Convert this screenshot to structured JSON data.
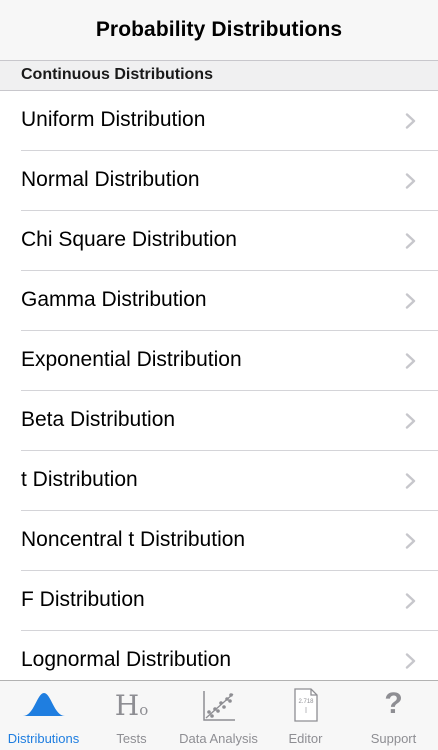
{
  "header": {
    "title": "Probability Distributions"
  },
  "section": {
    "title": "Continuous Distributions"
  },
  "list": {
    "items": [
      "Uniform Distribution",
      "Normal Distribution",
      "Chi Square Distribution",
      "Gamma Distribution",
      "Exponential Distribution",
      "Beta Distribution",
      "t Distribution",
      "Noncentral t Distribution",
      "F Distribution",
      "Lognormal Distribution"
    ]
  },
  "tabbar": {
    "tabs": [
      {
        "label": "Distributions",
        "icon": "bell-curve-icon",
        "active": true
      },
      {
        "label": "Tests",
        "icon": "hypothesis-icon",
        "glyph": "H",
        "subscript": "o"
      },
      {
        "label": "Data Analysis",
        "icon": "scatter-plot-icon"
      },
      {
        "label": "Editor",
        "icon": "document-icon",
        "doc_text": "2.718"
      },
      {
        "label": "Support",
        "icon": "question-mark-icon",
        "glyph": "?"
      }
    ]
  },
  "colors": {
    "active": "#1f7ee0",
    "inactive": "#8e8e93",
    "chevron": "#c7c7cc"
  }
}
